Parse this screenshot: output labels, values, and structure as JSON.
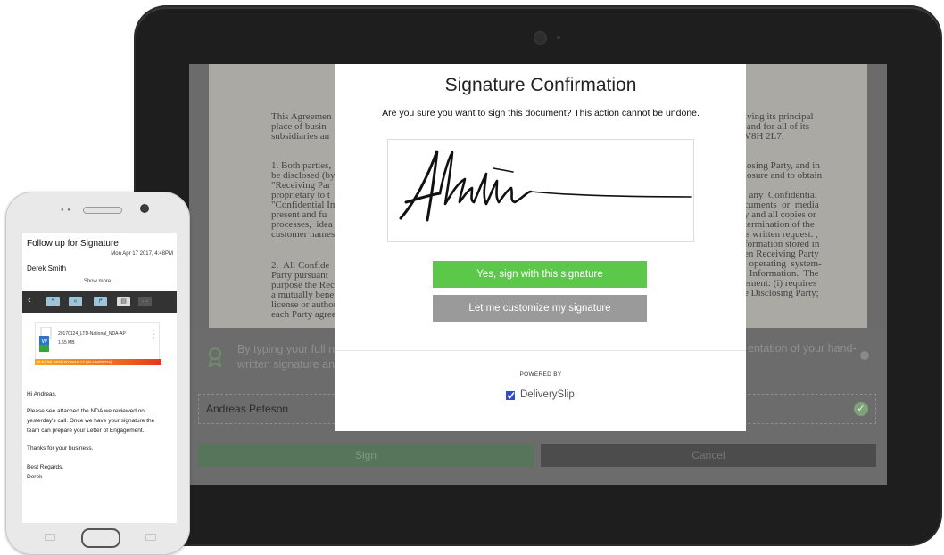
{
  "tablet": {
    "document": {
      "para1_left": "This Agreemen\nplace of busin\nsubsidiaries an",
      "para1_right": "iving its principal\n and for all of its\nV8H 2L7.",
      "para2_left": "1. Both parties,\nbe disclosed (by\n\"Receiving Par\nproprietary to t\n\"Confidential In\npresent and fu\nprocesses,  idea\ncustomer names",
      "para2_right": "losing Party, and in\nlosure and to obtain\n\n  any  Confidential\ncuments  or  media\ny and all copies or\ntermination of the\n's written request. ,\nformation stored in\nen Receiving Party\n  operating  system-\nl Information.  The\nement: (i) requires\ne Disclosing Party;",
      "para3_left": "2.  All Confide\nParty pursuant\npurpose the Rec\na mutually bene\nlicense or author\neach Party agree"
    },
    "legal_left": "By typing your full na\nwritten signature and",
    "legal_right": "entation of your hand-",
    "name_value": "Andreas Peteson",
    "sign_label": "Sign",
    "cancel_label": "Cancel",
    "modal": {
      "title": "Signature Confirmation",
      "subtitle": "Are you sure you want to sign this document? This action cannot be undone.",
      "yes_label": "Yes, sign with this signature",
      "customize_label": "Let me customize my signature",
      "powered_by": "POWERED BY",
      "brand": "DeliverySlip"
    }
  },
  "phone": {
    "title": "Follow up for Signature",
    "date": "Mon Apr 17 2017, 4:48PM",
    "from": "Derek Smith",
    "show_more": "Show more...",
    "attachment_name": "20170124_LTD-National_NDA-AP",
    "attachment_size": "1.55 MB",
    "banner": "PLEASE SIGN BY MAY 17 (IN A MONTH)",
    "greeting": "Hi Andreas,",
    "body": "Please see attached the NDA we reviewed on\nyesterday's call. Once we have your signature the\nteam can prepare your Letter of Engagement.",
    "thanks": "Thanks for your business.",
    "signoff": "Best Regards,\nDerek"
  },
  "colors": {
    "accent_green": "#5bc84a",
    "grey_button": "#9a9a9a",
    "brand_blue": "#2f4cc9"
  }
}
